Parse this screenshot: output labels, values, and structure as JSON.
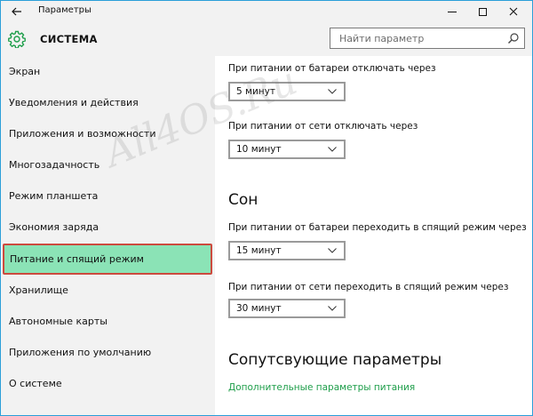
{
  "window": {
    "title": "Параметры",
    "back_icon": "arrow-left-icon",
    "controls": [
      "minimize-icon",
      "maximize-icon",
      "close-icon"
    ]
  },
  "header": {
    "icon": "gear-icon",
    "title": "СИСТЕМА",
    "search_placeholder": "Найти параметр",
    "search_icon": "search-icon"
  },
  "sidebar": {
    "items": [
      {
        "label": "Экран"
      },
      {
        "label": "Уведомления и действия"
      },
      {
        "label": "Приложения и возможности"
      },
      {
        "label": "Многозадачность"
      },
      {
        "label": "Режим планшета"
      },
      {
        "label": "Экономия заряда"
      },
      {
        "label": "Питание и спящий режим",
        "selected": true
      },
      {
        "label": "Хранилище"
      },
      {
        "label": "Автономные карты"
      },
      {
        "label": "Приложения по умолчанию"
      },
      {
        "label": "О системе"
      }
    ]
  },
  "main": {
    "screen": {
      "battery_label": "При питании от батареи отключать через",
      "battery_value": "5 минут",
      "plugged_label": "При питании от сети отключать через",
      "plugged_value": "10 минут"
    },
    "sleep": {
      "heading": "Сон",
      "battery_label": "При питании от батареи переходить в спящий режим через",
      "battery_value": "15 минут",
      "plugged_label": "При питании от сети переходить в спящий режим через",
      "plugged_value": "30 минут"
    },
    "related": {
      "heading": "Сопутсвующие параметры",
      "link": "Дополнительные параметры питания"
    }
  },
  "watermark": "All4OS.Ru",
  "colors": {
    "accent_border": "#2b9fd9",
    "selected_bg": "#8be3b6",
    "selected_border": "#cc4a3e",
    "link": "#1e9e4a",
    "sidebar_bg": "#f2f2f2"
  }
}
